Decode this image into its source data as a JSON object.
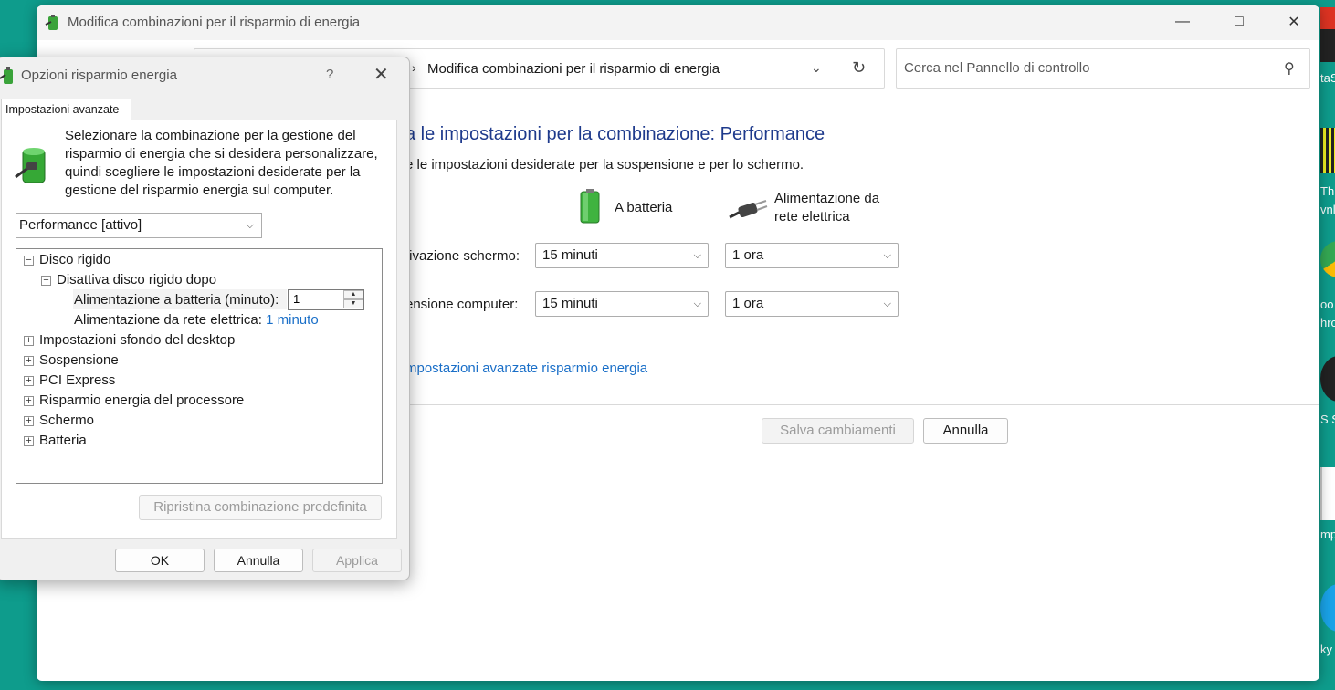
{
  "main_window": {
    "title": "Modifica combinazioni per il risparmio di energia",
    "breadcrumb": "Modifica combinazioni per il risparmio di energia",
    "search_placeholder": "Cerca nel Pannello di controllo",
    "heading": "a le impostazioni per la combinazione: Performance",
    "subheading": "e le impostazioni desiderate per la sospensione e per lo schermo.",
    "col_battery": "A batteria",
    "col_ac": "Alimentazione da rete elettrica",
    "row_display": "tivazione schermo:",
    "row_sleep": "ensione computer:",
    "display_battery": "15 minuti",
    "display_ac": "1 ora",
    "sleep_battery": "15 minuti",
    "sleep_ac": "1 ora",
    "advanced_link": "mpostazioni avanzate risparmio energia",
    "save_label": "Salva cambiamenti",
    "cancel_label": "Annulla"
  },
  "dialog": {
    "title": "Opzioni risparmio energia",
    "help": "?",
    "tab_label": "Impostazioni avanzate",
    "intro": "Selezionare la combinazione per la gestione del risparmio di energia che si desidera personalizzare, quindi scegliere le impostazioni desiderate per la gestione del risparmio energia sul computer.",
    "plan_value": "Performance [attivo]",
    "tree": {
      "disk": "Disco rigido",
      "disk_off": "Disattiva disco rigido dopo",
      "battery_label": "Alimentazione a batteria (minuto):",
      "battery_value": "1",
      "ac_label": "Alimentazione da rete elettrica:",
      "ac_value": "1 minuto",
      "desktop": "Impostazioni sfondo del desktop",
      "sleep": "Sospensione",
      "pci": "PCI Express",
      "cpu": "Risparmio energia del processore",
      "screen": "Schermo",
      "battery": "Batteria"
    },
    "restore_label": "Ripristina combinazione predefinita",
    "ok_label": "OK",
    "cancel_label": "Annulla",
    "apply_label": "Applica"
  },
  "desktop_icons": [
    {
      "label": "taS"
    },
    {
      "label": "Th"
    },
    {
      "label": "vnl"
    },
    {
      "label": "oo"
    },
    {
      "label": "hro"
    },
    {
      "label": "S S"
    },
    {
      "label": "mp"
    },
    {
      "label": "ky"
    }
  ],
  "colors": {
    "desktop": "#0e9c8c",
    "heading": "#1e3a8c",
    "link": "#1a6fc8"
  }
}
